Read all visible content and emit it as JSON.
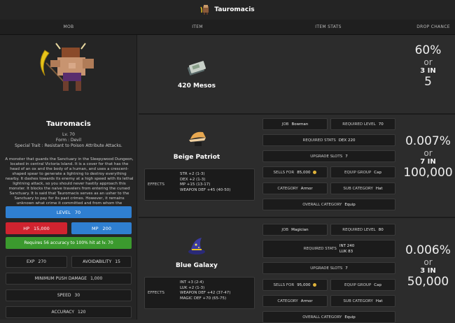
{
  "topbar": {
    "title": "Tauromacis"
  },
  "columns": {
    "mob": "MOB",
    "item": "ITEM",
    "item_stats": "ITEM STATS",
    "drop_chance": "DROP CHANCE"
  },
  "mob": {
    "name": "Tauromacis",
    "level_line": "Lv. 70",
    "form_line": "Form : Devil",
    "trait_line": "Special Trait : Resistant to Poison Attribute Attacks.",
    "description": "A monster that guards the Sanctuary in the Sleepywood Dungeon, located in central Victoria Island. It is a cover for that has the head of an ox and the body of a human, and uses a crescent-shaped spear to generate a lightning to destroy everything nearby. It dashes towards its enemy at a high speed with its lethal lightning attack, so you should never hastily approach this monster. It blocks the naive travelers from entering the cursed Sanctuary. It is said that Tauromacis serves as an usher to the Sanctuary to pay for its past crimes. However, it remains unknown what crime it committed and from whom the punishment is coming from.",
    "level_label": "LEVEL",
    "level_value": "70",
    "hp_label": "HP",
    "hp_value": "15,000",
    "mp_label": "MP",
    "mp_value": "200",
    "accuracy_note": "Requires 56 accuracy to 100% hit at lv. 70",
    "exp_label": "EXP",
    "exp_value": "270",
    "avoid_label": "AVOIDABILITY",
    "avoid_value": "15",
    "mpd_label": "MINIMUM PUSH DAMAGE",
    "mpd_value": "1,000",
    "speed_label": "SPEED",
    "speed_value": "30",
    "acc_label": "ACCURACY",
    "acc_value": "120"
  },
  "drops": [
    {
      "name": "420 Mesos",
      "icon": "meso-bill-icon",
      "pct": "60%",
      "or": "or",
      "x_in": "3 IN",
      "big": "5"
    },
    {
      "name": "Beige Patriot",
      "icon": "beige-hat-icon",
      "effects_label": "EFFECTS",
      "effects": [
        "STR +2 (1-3)",
        "DEX +2 (1-3)",
        "MP +15 (13-17)",
        "WEAPON DEF +45 (40-50)"
      ],
      "job_label": "JOB",
      "job_value": "Bowman",
      "reqlv_label": "REQUIRED LEVEL",
      "reqlv_value": "70",
      "reqstats_label": "REQUIRED STATS",
      "reqstats_value": "DEX 220",
      "slots_label": "UPGRADE SLOTS",
      "slots_value": "7",
      "sells_label": "SELLS FOR",
      "sells_value": "85,000",
      "eqgroup_label": "EQUIP GROUP",
      "eqgroup_value": "Cap",
      "cat_label": "CATEGORY",
      "cat_value": "Armor",
      "subcat_label": "SUB CATEGORY",
      "subcat_value": "Hat",
      "overall_label": "OVERALL CATEGORY",
      "overall_value": "Equip",
      "pct": "0.007%",
      "or": "or",
      "x_in": "7 IN",
      "big": "100,000"
    },
    {
      "name": "Blue Galaxy",
      "icon": "wizard-hat-icon",
      "effects_label": "EFFECTS",
      "effects": [
        "INT +3 (2-4)",
        "LUK +2 (1-3)",
        "WEAPON DEF +42 (37-47)",
        "MAGIC DEF +70 (65-75)"
      ],
      "job_label": "JOB",
      "job_value": "Magician",
      "reqlv_label": "REQUIRED LEVEL",
      "reqlv_value": "80",
      "reqstats_label": "REQUIRED STATS",
      "reqstats_value1": "INT 240",
      "reqstats_value2": "LUK 83",
      "slots_label": "UPGRADE SLOTS",
      "slots_value": "7",
      "sells_label": "SELLS FOR",
      "sells_value": "95,000",
      "eqgroup_label": "EQUIP GROUP",
      "eqgroup_value": "Cap",
      "cat_label": "CATEGORY",
      "cat_value": "Armor",
      "subcat_label": "SUB CATEGORY",
      "subcat_value": "Hat",
      "overall_label": "OVERALL CATEGORY",
      "overall_value": "Equip",
      "pct": "0.006%",
      "or": "or",
      "x_in": "3 IN",
      "big": "50,000"
    }
  ],
  "colors": {
    "level_bar": "#2f7fd1",
    "hp_bar": "#d0232f",
    "mp_bar": "#2f7fd1",
    "accuracy_bar": "#3b9a2e",
    "coin": "#e0b33a"
  }
}
